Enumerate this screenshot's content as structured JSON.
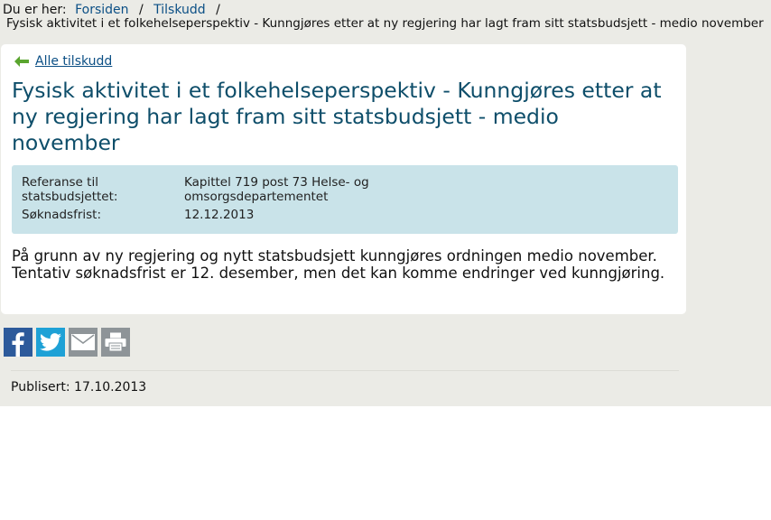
{
  "breadcrumb": {
    "prefix": "Du er her:",
    "items": [
      "Forsiden",
      "Tilskudd"
    ],
    "separator": "/",
    "current": "Fysisk aktivitet i et folkehelseperspektiv - Kunngjøres etter at ny regjering har lagt fram sitt statsbudsjett - medio november"
  },
  "back_link": {
    "label": "Alle tilskudd",
    "icon": "arrow-left-icon"
  },
  "title": "Fysisk aktivitet i et folkehelseperspektiv - Kunngjøres etter at ny regjering har lagt fram sitt statsbudsjett - medio november",
  "info": {
    "reference_label": "Referanse til statsbudsjettet:",
    "reference_value": "Kapittel 719 post 73 Helse- og omsorgsdepartementet",
    "deadline_label": "Søknadsfrist:",
    "deadline_value": "12.12.2013"
  },
  "body": "På grunn av ny regjering og nytt statsbudsjett kunngjøres ordningen medio november. Tentativ søknadsfrist er 12. desember, men det kan komme endringer ved kunngjøring.",
  "share": {
    "icons": [
      "facebook-icon",
      "twitter-icon",
      "mail-icon",
      "print-icon"
    ]
  },
  "published": "Publisert: 17.10.2013",
  "colors": {
    "link": "#0b4f85",
    "title": "#0e4e6a",
    "info_bg": "#c9e3e9",
    "page_bg": "#ebebe6",
    "facebook": "#2d5a9b",
    "twitter": "#1ea1d6",
    "grey_icon": "#8e9498",
    "arrow": "#5aa52f"
  }
}
